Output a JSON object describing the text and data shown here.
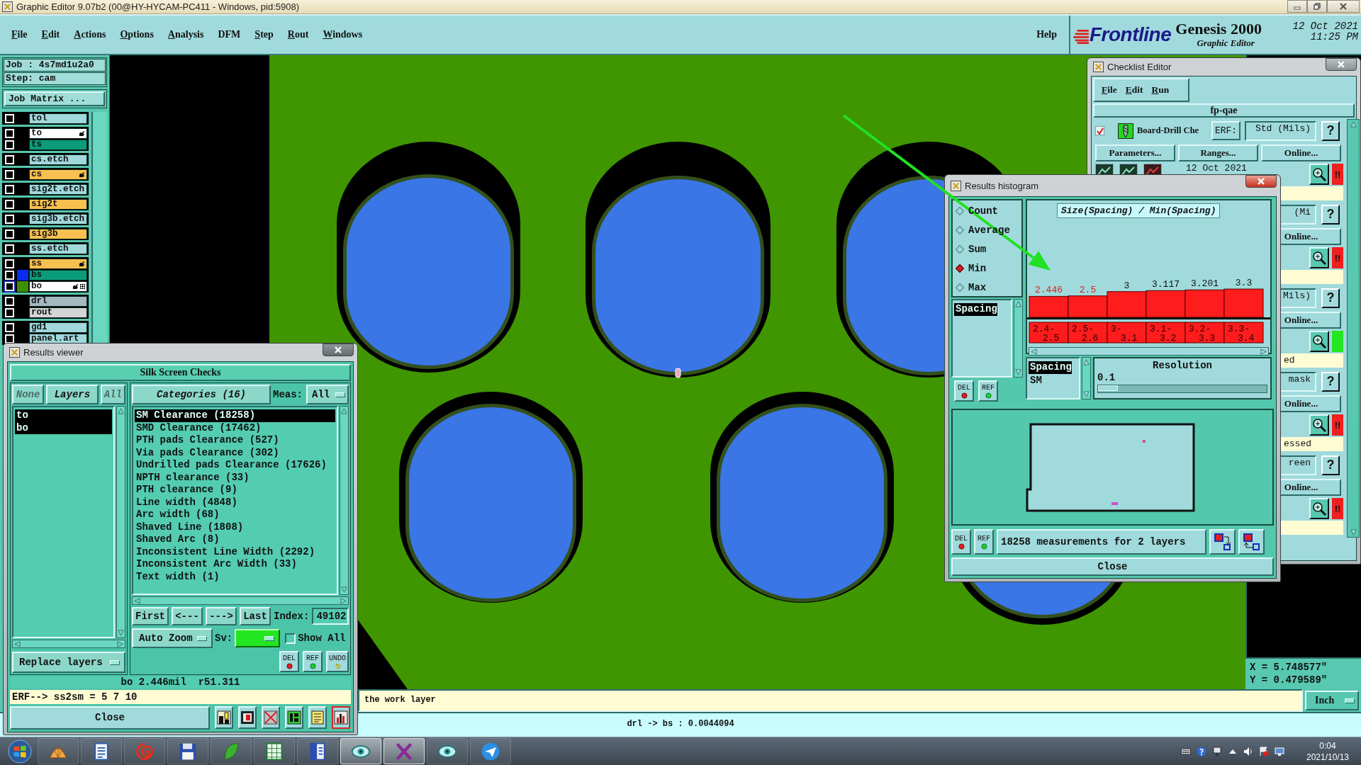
{
  "window": {
    "title": "Graphic Editor 9.07b2 (00@HY-HYCAM-PC411 - Windows, pid:5908)"
  },
  "menu": [
    {
      "label": "File",
      "mnemonic": true
    },
    {
      "label": "Edit",
      "mnemonic": true
    },
    {
      "label": "Actions",
      "mnemonic": true
    },
    {
      "label": "Options",
      "mnemonic": true
    },
    {
      "label": "Analysis",
      "mnemonic": true
    },
    {
      "label": "DFM",
      "mnemonic": false
    },
    {
      "label": "Step",
      "mnemonic": true
    },
    {
      "label": "Rout",
      "mnemonic": true
    },
    {
      "label": "Windows",
      "mnemonic": true
    }
  ],
  "help_menu": "Help",
  "branding": {
    "logo": "Frontline",
    "product": "Genesis 2000",
    "subtitle": "Graphic Editor",
    "date": "12 Oct 2021",
    "time": "11:25 PM"
  },
  "job_panel": {
    "job": "Job : 4s7md1u2a0",
    "step": "Step: cam",
    "matrix_button": "Job Matrix ...",
    "layer_groups": [
      {
        "layers": [
          {
            "name": "tol",
            "color": "#a0d8dc",
            "checked": false,
            "affected": false,
            "work": false
          }
        ]
      },
      {
        "layers": [
          {
            "name": "to",
            "color": "#ffffff",
            "checked": false,
            "affected": true,
            "work": false
          },
          {
            "name": "ts",
            "color": "#0a9c7a",
            "checked": false,
            "affected": false,
            "work": false
          }
        ]
      },
      {
        "layers": [
          {
            "name": "cs.etch",
            "color": "#a0d8dc",
            "checked": false,
            "affected": false,
            "work": false
          }
        ]
      },
      {
        "layers": [
          {
            "name": "cs",
            "color": "#f8c050",
            "checked": false,
            "affected": true,
            "work": false
          }
        ]
      },
      {
        "layers": [
          {
            "name": "sig2t.etch",
            "color": "#a0d8dc",
            "checked": false,
            "affected": false,
            "work": false
          }
        ]
      },
      {
        "layers": [
          {
            "name": "sig2t",
            "color": "#f8c050",
            "checked": false,
            "affected": false,
            "work": false
          }
        ]
      },
      {
        "layers": [
          {
            "name": "sig3b.etch",
            "color": "#a0d8dc",
            "checked": false,
            "affected": false,
            "work": false
          }
        ]
      },
      {
        "layers": [
          {
            "name": "sig3b",
            "color": "#f8c050",
            "checked": false,
            "affected": false,
            "work": false
          }
        ]
      },
      {
        "layers": [
          {
            "name": "ss.etch",
            "color": "#a0d8dc",
            "checked": false,
            "affected": false,
            "work": false
          }
        ]
      },
      {
        "layers": [
          {
            "name": "ss",
            "color": "#f8c050",
            "checked": false,
            "affected": true,
            "work": false
          },
          {
            "name": "bs",
            "color": "#0a9c7a",
            "swatch": {
              "color": "#0a2cf0"
            },
            "checked": false,
            "affected": false,
            "work": false
          },
          {
            "name": "bo",
            "color": "#ffffff",
            "swatch": {
              "color": "#3c9000"
            },
            "checked": false,
            "affected": true,
            "work": true
          }
        ]
      },
      {
        "layers": [
          {
            "name": "drl",
            "color": "#a4b8c0",
            "checked": false,
            "affected": false,
            "work": false
          },
          {
            "name": "rout",
            "color": "#d4d4d4",
            "checked": false,
            "affected": false,
            "work": false
          }
        ]
      },
      {
        "layers": [
          {
            "name": "gd1",
            "color": "#a0d8dc",
            "checked": false,
            "affected": false,
            "work": false
          },
          {
            "name": "panel.art",
            "color": "#a0d8dc",
            "checked": false,
            "affected": false,
            "work": false
          }
        ]
      }
    ]
  },
  "coordinates": {
    "x": "X = 5.748577\"",
    "y": "Y = 0.479589\""
  },
  "message_bar": {
    "text": "the work layer",
    "units": "Inch"
  },
  "status_bar": {
    "text": "drl -> bs : 0.0044094"
  },
  "results_viewer": {
    "title": "Results viewer",
    "heading": "Silk Screen Checks",
    "filter_buttons": [
      {
        "label": "None",
        "disabled": true
      },
      {
        "label": "Layers",
        "disabled": false
      },
      {
        "label": "All",
        "disabled": true
      }
    ],
    "layers": [
      {
        "name": "to",
        "selected": true
      },
      {
        "name": "bo",
        "selected": true
      }
    ],
    "replace_layers": "Replace layers",
    "categories_button": "Categories (16)",
    "meas_label": "Meas:",
    "meas_value": "All",
    "categories": [
      {
        "label": "SM Clearance (18258)",
        "selected": true
      },
      {
        "label": "SMD Clearance (17462)",
        "selected": false
      },
      {
        "label": "PTH pads Clearance (527)",
        "selected": false
      },
      {
        "label": "Via pads Clearance (302)",
        "selected": false
      },
      {
        "label": "Undrilled pads Clearance (17626)",
        "selected": false
      },
      {
        "label": "NPTH clearance (33)",
        "selected": false
      },
      {
        "label": "PTH clearance (9)",
        "selected": false
      },
      {
        "label": "Line width (4848)",
        "selected": false
      },
      {
        "label": "Arc width (68)",
        "selected": false
      },
      {
        "label": "Shaved Line (1808)",
        "selected": false
      },
      {
        "label": "Shaved Arc (8)",
        "selected": false
      },
      {
        "label": "Inconsistent Line Width (2292)",
        "selected": false
      },
      {
        "label": "Inconsistent Arc Width (33)",
        "selected": false
      },
      {
        "label": "Text width (1)",
        "selected": false
      }
    ],
    "nav_buttons": [
      "First",
      "<---",
      "--->",
      "Last"
    ],
    "index_label": "Index:",
    "index_value": "49102",
    "zoom_mode": "Auto Zoom",
    "sv_label": "Sv:",
    "severity": {
      "color": "#22e622"
    },
    "show_all": {
      "label": "Show All",
      "checked": false
    },
    "action_buttons": [
      {
        "label": "DEL",
        "kind": "delete"
      },
      {
        "label": "REF",
        "kind": "refresh"
      },
      {
        "label": "UNDO",
        "kind": "undo"
      }
    ],
    "measurement": "bo 2.446mil  r51.311",
    "erf_line": "ERF--> ss2sm = 5 7 10",
    "close": "Close",
    "tools": [
      {
        "kind": "layers",
        "selected": false
      },
      {
        "kind": "stop",
        "selected": false
      },
      {
        "kind": "clear",
        "selected": false
      },
      {
        "kind": "numbers",
        "selected": false
      },
      {
        "kind": "report",
        "selected": false
      },
      {
        "kind": "histogram",
        "selected": true
      }
    ]
  },
  "checklist_editor": {
    "title": "Checklist Editor",
    "menu": [
      {
        "label": "File",
        "mnemonic": true
      },
      {
        "label": "Edit",
        "mnemonic": true
      },
      {
        "label": "Run",
        "mnemonic": true
      }
    ],
    "checklist_name": "fp-qae",
    "checks": [
      {
        "checked": true,
        "name": "Board-Drill Che",
        "erf_label": "ERF:",
        "erf_value": "Std (Mils)",
        "help": "?",
        "buttons": [
          "Parameters...",
          "Ranges...",
          "Online..."
        ],
        "date": "12 Oct 2021",
        "color": "#ee2020",
        "flag": "!!"
      },
      {
        "erf_value": "(Mi",
        "help": "?",
        "buttons": [
          "Online..."
        ],
        "color": "#ee2020",
        "flag": "!!"
      },
      {
        "erf_value": "Mils)",
        "help": "?",
        "buttons": [
          "Online..."
        ],
        "color": "#22e622",
        "message": "ed"
      },
      {
        "erf_value": "mask",
        "help": "?",
        "buttons": [
          "Online..."
        ],
        "color": "#ee2020",
        "flag": "!!",
        "message": "essed"
      },
      {
        "erf_value": "reen",
        "help": "?",
        "buttons": [
          "Online..."
        ],
        "color": "#ee2020",
        "flag": "!!"
      }
    ]
  },
  "histogram": {
    "title": "Results histogram",
    "modes": [
      {
        "label": "Count",
        "selected": false
      },
      {
        "label": "Average",
        "selected": false
      },
      {
        "label": "Sum",
        "selected": false
      },
      {
        "label": "Min",
        "selected": true
      },
      {
        "label": "Max",
        "selected": false
      }
    ],
    "attributes": [
      {
        "label": "Spacing",
        "selected": true
      }
    ],
    "side_buttons": [
      {
        "label": "DEL",
        "kind": "delete"
      },
      {
        "label": "REF",
        "kind": "refresh"
      }
    ],
    "chart_data": {
      "type": "bar",
      "title": "Size(Spacing) / Min(Spacing)",
      "categories": [
        "2.4-2.5",
        "2.5-2.6",
        "3-3.1",
        "3.1-3.2",
        "3.2-3.3",
        "3.3-3.4"
      ],
      "values": [
        2.446,
        2.5,
        3,
        3.117,
        3.201,
        3.3
      ],
      "data_labels": true
    },
    "label_highlighted": [
      true,
      true,
      false,
      false,
      false,
      false
    ],
    "group_list": [
      {
        "label": "Spacing",
        "selected": true
      },
      {
        "label": "SM",
        "selected": false
      }
    ],
    "resolution": {
      "label": "Resolution",
      "value": "0.1",
      "level": 0
    },
    "bottom_buttons": [
      {
        "label": "DEL",
        "kind": "delete"
      },
      {
        "label": "REF",
        "kind": "refresh"
      }
    ],
    "summary": "18258 measurements for 2 layers",
    "close": "Close"
  },
  "taskbar": {
    "apps": [
      {
        "kind": "shell",
        "active": false
      },
      {
        "kind": "notepad",
        "active": false
      },
      {
        "kind": "swirl",
        "active": false
      },
      {
        "kind": "floppy",
        "active": false
      },
      {
        "kind": "leaf",
        "active": false
      },
      {
        "kind": "spreadsheet",
        "active": false
      },
      {
        "kind": "document",
        "active": false
      },
      {
        "kind": "eye",
        "active": true
      },
      {
        "kind": "cross",
        "active": true
      },
      {
        "kind": "eye",
        "active": false
      },
      {
        "kind": "plane",
        "active": false
      }
    ],
    "time": "0:04",
    "date": "2021/10/13"
  }
}
